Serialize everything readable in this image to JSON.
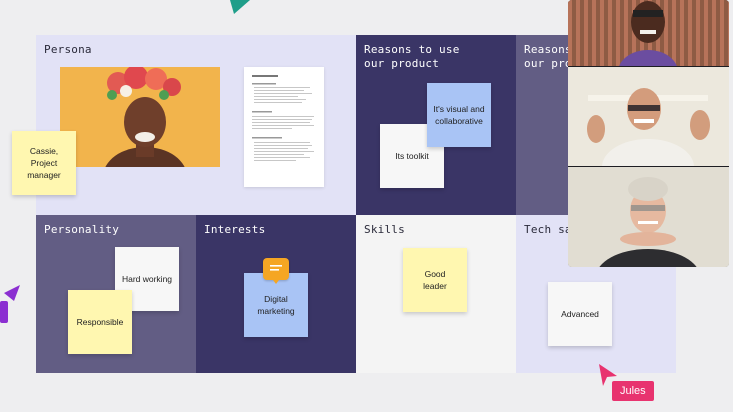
{
  "board": {
    "persona": {
      "title": "Persona"
    },
    "reasons": {
      "title": "Reasons to use\nour product"
    },
    "reasons_overflow": {
      "title": "Reasons\nour pro"
    },
    "personality": {
      "title": "Personality"
    },
    "interests": {
      "title": "Interests"
    },
    "skills": {
      "title": "Skills"
    },
    "tech": {
      "title": "Tech sav"
    }
  },
  "stickies": {
    "cassie": "Cassie,\nProject\nmanager",
    "visual": "It's visual and\ncollaborative",
    "toolkit": "Its toolkit",
    "hard_working": "Hard working",
    "responsible": "Responsible",
    "digital_marketing": "Digital\nmarketing",
    "good_leader": "Good\nleader",
    "advanced": "Advanced"
  },
  "collaborator": {
    "name": "Jules"
  },
  "colors": {
    "persona_bg": "#e2e2f6",
    "reasons_bg": "#3a3566",
    "personality_bg": "#625d84",
    "interests_bg": "#3a3566",
    "skills_bg": "#f4f4f4",
    "tech_bg": "#e2e2f6",
    "accent_pink": "#e8336f",
    "accent_purple": "#8b2fd1",
    "accent_teal": "#1f9e8a",
    "comment_orange": "#f5a623"
  }
}
